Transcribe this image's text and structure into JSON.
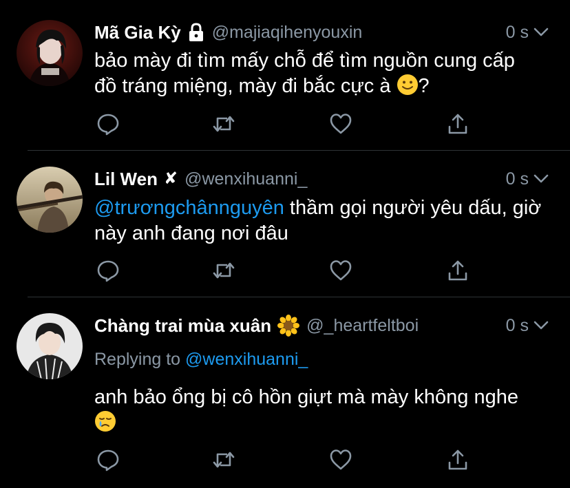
{
  "colors": {
    "background": "#000000",
    "text": "#ffffff",
    "secondary": "#8b98a5",
    "link": "#1d9bf0",
    "divider": "#2f3336"
  },
  "tweets": [
    {
      "name": "Mã Gia Kỳ",
      "badge_icon": "lock-icon",
      "handle": "@majiaqihenyouxin",
      "time": "0 s",
      "text_plain": "bảo mày đi tìm mấy chỗ để tìm nguồn cung cấp đồ tráng miệng, mày đi bắc cực à",
      "text_suffix": "?",
      "emoji": "slightly-smiling-face-emoji"
    },
    {
      "name": "Lil Wen",
      "badge": "✘",
      "handle": "@wenxihuanni_",
      "time": "0 s",
      "mention": "@trươngchânnguyên",
      "text_plain": " thầm gọi người yêu dấu, giờ này anh đang nơi đâu"
    },
    {
      "name": "Chàng trai mùa xuân",
      "badge_icon": "sunflower-emoji",
      "handle": "@_heartfeltboi",
      "time": "0 s",
      "replying_to_label": "Replying to",
      "replying_to_handle": "@wenxihuanni_",
      "text_plain": "anh bảo ổng bị cô hồn giựt mà mày không nghe",
      "emoji": "crying-face-emoji"
    }
  ],
  "actions": [
    "reply-icon",
    "retweet-icon",
    "like-icon",
    "share-icon"
  ]
}
